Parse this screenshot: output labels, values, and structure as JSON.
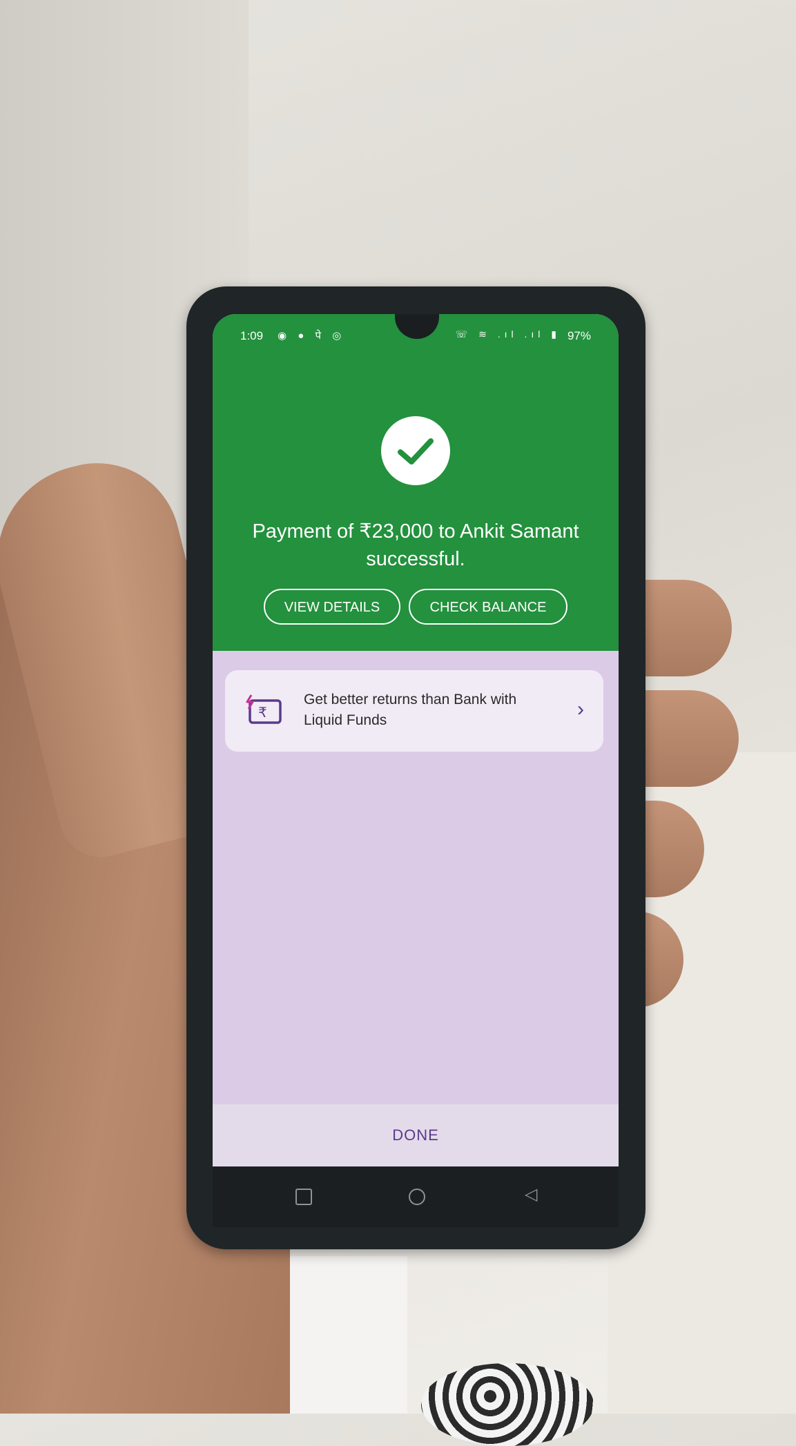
{
  "status_bar": {
    "time": "1:09",
    "left_icons": "◉ ● पे ◎",
    "right_icons": "☏ ≋ .ıl .ıl ▮",
    "battery": "97%"
  },
  "success": {
    "message": "Payment of ₹23,000 to Ankit Samant successful.",
    "view_details_label": "VIEW DETAILS",
    "check_balance_label": "CHECK BALANCE"
  },
  "promo": {
    "text": "Get better returns than Bank with Liquid Funds",
    "chevron": "›"
  },
  "footer": {
    "done_label": "DONE"
  },
  "nav": {
    "back_glyph": "◁"
  },
  "colors": {
    "success_green": "#23913d",
    "accent_purple": "#5a3a8c",
    "content_bg": "#dccbe7"
  }
}
